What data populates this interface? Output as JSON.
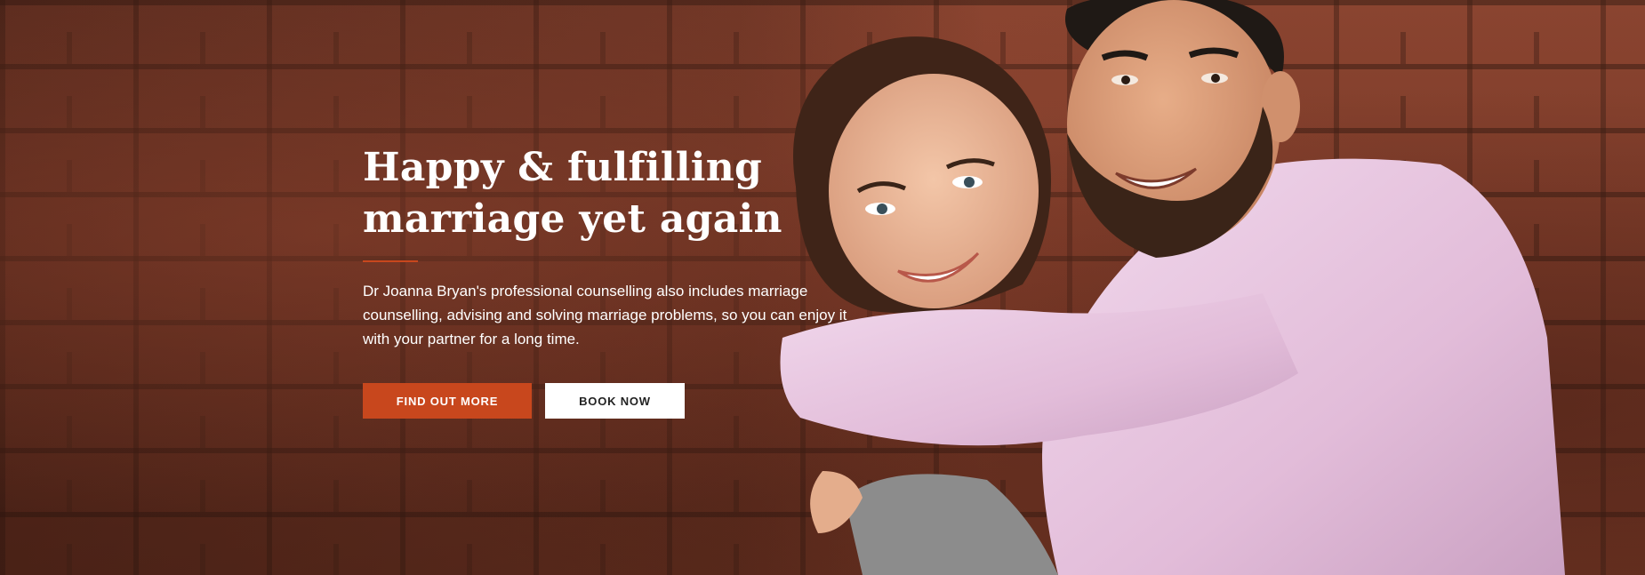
{
  "hero": {
    "headline_line1": "Happy & fulfilling",
    "headline_line2": "marriage yet again",
    "description": "Dr Joanna Bryan's professional counselling also includes marriage counselling, advising and solving marriage problems, so you can enjoy it with your partner for a long time.",
    "primary_button": "FIND OUT MORE",
    "secondary_button": "BOOK NOW"
  },
  "colors": {
    "accent": "#c8471d",
    "text": "#ffffff",
    "brick": "#7b3a28"
  }
}
